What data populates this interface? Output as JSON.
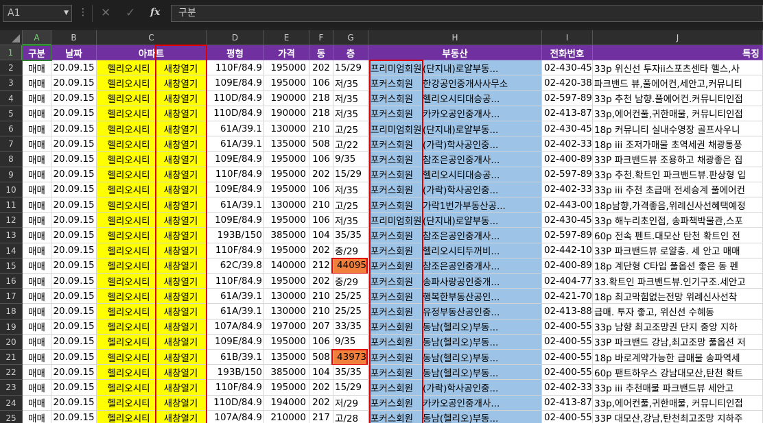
{
  "formula_bar": {
    "name_box": "A1",
    "dropdown_icon": "chevron-down-icon",
    "more_icon": "⋮",
    "cancel_icon": "✕",
    "enter_icon": "✓",
    "fx_label": "fx",
    "content": "구분"
  },
  "columns": [
    "A",
    "B",
    "C",
    "D",
    "E",
    "F",
    "G",
    "H",
    "I",
    "J"
  ],
  "headers": [
    "구분",
    "날짜",
    "아파트",
    "",
    "평형",
    "가격",
    "동",
    "층",
    "부동산",
    "",
    "전화번호",
    "특징"
  ],
  "rows": [
    {
      "n": "2",
      "a": "매매",
      "b": "20.09.15",
      "c1": "헬리오시티",
      "c2": "새창열기",
      "d": "110F/84.9",
      "e": "195000",
      "f": "202",
      "g": "15/29",
      "h1": "프리미엄회원",
      "h2": "(단지내)로얄부동...",
      "i": "02-430-45",
      "j": "33p 위신선 투자ii스포츠센타 헬스,사"
    },
    {
      "n": "3",
      "a": "매매",
      "b": "20.09.15",
      "c1": "헬리오시티",
      "c2": "새창열기",
      "d": "109E/84.9",
      "e": "195000",
      "f": "106",
      "g": "저/35",
      "h1": "포커스회원",
      "h2": "한강공인중개사사무소",
      "i": "02-420-38",
      "j": "파크밴드 뷰,풀에어컨,세안고,커뮤니티"
    },
    {
      "n": "4",
      "a": "매매",
      "b": "20.09.15",
      "c1": "헬리오시티",
      "c2": "새창열기",
      "d": "110D/84.9",
      "e": "190000",
      "f": "218",
      "g": "저/35",
      "h1": "포커스회원",
      "h2": "헬리오시티대승공...",
      "i": "02-597-89",
      "j": "33p 추천 남향.풀에어컨.커뮤니티인접"
    },
    {
      "n": "5",
      "a": "매매",
      "b": "20.09.15",
      "c1": "헬리오시티",
      "c2": "새창열기",
      "d": "110D/84.9",
      "e": "190000",
      "f": "218",
      "g": "저/35",
      "h1": "포커스회원",
      "h2": "카카오공인중개사...",
      "i": "02-413-87",
      "j": "33p,에어컨풀,귀한매물, 커뮤니티인접"
    },
    {
      "n": "6",
      "a": "매매",
      "b": "20.09.15",
      "c1": "헬리오시티",
      "c2": "새창열기",
      "d": "61A/39.1",
      "e": "130000",
      "f": "210",
      "g": "고/25",
      "h1": "프리미엄회원",
      "h2": "(단지내)로얄부동...",
      "i": "02-430-45",
      "j": "18p 커뮤니티 실내수영장 골프사우니"
    },
    {
      "n": "7",
      "a": "매매",
      "b": "20.09.15",
      "c1": "헬리오시티",
      "c2": "새창열기",
      "d": "61A/39.1",
      "e": "135000",
      "f": "508",
      "g": "고/22",
      "h1": "포커스회원",
      "h2": "(가락)학사공인중...",
      "i": "02-402-33",
      "j": "18p iii 조저가매물 초역세권 채광통풍"
    },
    {
      "n": "8",
      "a": "매매",
      "b": "20.09.15",
      "c1": "헬리오시티",
      "c2": "새창열기",
      "d": "109E/84.9",
      "e": "195000",
      "f": "106",
      "g": "9/35",
      "h1": "포커스회원",
      "h2": "참조은공인중개사...",
      "i": "02-400-89",
      "j": "33P 파크밴드뷰 조용하고 채광좋은 집"
    },
    {
      "n": "9",
      "a": "매매",
      "b": "20.09.15",
      "c1": "헬리오시티",
      "c2": "새창열기",
      "d": "110F/84.9",
      "e": "195000",
      "f": "202",
      "g": "15/29",
      "h1": "포커스회원",
      "h2": "헬리오시티대승공...",
      "i": "02-597-89",
      "j": "33p 추천.확트인 파크밴드뷰.판상형 입"
    },
    {
      "n": "10",
      "a": "매매",
      "b": "20.09.15",
      "c1": "헬리오시티",
      "c2": "새창열기",
      "d": "109E/84.9",
      "e": "195000",
      "f": "106",
      "g": "저/35",
      "h1": "포커스회원",
      "h2": "(가락)학사공인중...",
      "i": "02-402-33",
      "j": "33p iii 추천 초급매 전세승계 풀에어컨"
    },
    {
      "n": "11",
      "a": "매매",
      "b": "20.09.15",
      "c1": "헬리오시티",
      "c2": "새창열기",
      "d": "61A/39.1",
      "e": "130000",
      "f": "210",
      "g": "고/25",
      "h1": "포커스회원",
      "h2": "가락1번가부동산공...",
      "i": "02-443-00",
      "j": "18p남향,가격좋음,위례신사선혜택예정"
    },
    {
      "n": "12",
      "a": "매매",
      "b": "20.09.15",
      "c1": "헬리오시티",
      "c2": "새창열기",
      "d": "109E/84.9",
      "e": "195000",
      "f": "106",
      "g": "저/35",
      "h1": "프리미엄회원",
      "h2": "(단지내)로얄부동...",
      "i": "02-430-45",
      "j": "33p 해누리초인접, 송파책박물관,스포"
    },
    {
      "n": "13",
      "a": "매매",
      "b": "20.09.15",
      "c1": "헬리오시티",
      "c2": "새창열기",
      "d": "193B/150",
      "e": "385000",
      "f": "104",
      "g": "35/35",
      "h1": "포커스회원",
      "h2": "참조은공인중개사...",
      "i": "02-597-89",
      "j": "60p 전속 펜트.대모산 탄천 확트인 전"
    },
    {
      "n": "14",
      "a": "매매",
      "b": "20.09.15",
      "c1": "헬리오시티",
      "c2": "새창열기",
      "d": "110F/84.9",
      "e": "195000",
      "f": "202",
      "g": "중/29",
      "h1": "포커스회원",
      "h2": "헬리오시티두꺼비...",
      "i": "02-442-10",
      "j": "33P 파크밴드뷰 로얄층. 세 안고 매매"
    },
    {
      "n": "15",
      "a": "매매",
      "b": "20.09.15",
      "c1": "헬리오시티",
      "c2": "새창열기",
      "d": "62C/39.8",
      "e": "140000",
      "f": "212",
      "g": "44095",
      "h1": "포커스회원",
      "h2": "참조은공인중개사...",
      "i": "02-400-89",
      "j": "18p 계단형 C타입 풀옵션 좋은 동 펜"
    },
    {
      "n": "16",
      "a": "매매",
      "b": "20.09.15",
      "c1": "헬리오시티",
      "c2": "새창열기",
      "d": "110F/84.9",
      "e": "195000",
      "f": "202",
      "g": "중/29",
      "h1": "포커스회원",
      "h2": "송파사랑공인중개...",
      "i": "02-404-77",
      "j": "33.확트인 파크밴드뷰.인기구조.세안고"
    },
    {
      "n": "17",
      "a": "매매",
      "b": "20.09.15",
      "c1": "헬리오시티",
      "c2": "새창열기",
      "d": "61A/39.1",
      "e": "130000",
      "f": "210",
      "g": "25/25",
      "h1": "포커스회원",
      "h2": "행복한부동산공인...",
      "i": "02-421-70",
      "j": "18p 최고막힘없는전망 위례신사선착"
    },
    {
      "n": "18",
      "a": "매매",
      "b": "20.09.15",
      "c1": "헬리오시티",
      "c2": "새창열기",
      "d": "61A/39.1",
      "e": "130000",
      "f": "210",
      "g": "25/25",
      "h1": "포커스회원",
      "h2": "유정부동산공인중...",
      "i": "02-413-88",
      "j": "급매. 투자 좋고, 위신선 수혜동"
    },
    {
      "n": "19",
      "a": "매매",
      "b": "20.09.15",
      "c1": "헬리오시티",
      "c2": "새창열기",
      "d": "107A/84.9",
      "e": "197000",
      "f": "207",
      "g": "33/35",
      "h1": "포커스회원",
      "h2": "동남(헬리오)부동...",
      "i": "02-400-55",
      "j": "33p 남향 최고조망권 단지 중앙 지하"
    },
    {
      "n": "20",
      "a": "매매",
      "b": "20.09.15",
      "c1": "헬리오시티",
      "c2": "새창열기",
      "d": "109E/84.9",
      "e": "195000",
      "f": "106",
      "g": "9/35",
      "h1": "포커스회원",
      "h2": "동남(헬리오)부동...",
      "i": "02-400-55",
      "j": "33P 파크밴드 강남,최고조망 풀옵션 저"
    },
    {
      "n": "21",
      "a": "매매",
      "b": "20.09.15",
      "c1": "헬리오시티",
      "c2": "새창열기",
      "d": "61B/39.1",
      "e": "135000",
      "f": "508",
      "g": "43973",
      "h1": "포커스회원",
      "h2": "동남(헬리오)부동...",
      "i": "02-400-55",
      "j": "18p 바로계약가능한 급매물 송파역세"
    },
    {
      "n": "22",
      "a": "매매",
      "b": "20.09.15",
      "c1": "헬리오시티",
      "c2": "새창열기",
      "d": "193B/150",
      "e": "385000",
      "f": "104",
      "g": "35/35",
      "h1": "포커스회원",
      "h2": "동남(헬리오)부동...",
      "i": "02-400-55",
      "j": "60p 팬트하우스 강남대모산,탄천 확트"
    },
    {
      "n": "23",
      "a": "매매",
      "b": "20.09.15",
      "c1": "헬리오시티",
      "c2": "새창열기",
      "d": "110F/84.9",
      "e": "195000",
      "f": "202",
      "g": "15/29",
      "h1": "포커스회원",
      "h2": "(가락)학사공인중...",
      "i": "02-402-33",
      "j": "33p iii 추천매물 파크밴드뷰 세안고"
    },
    {
      "n": "24",
      "a": "매매",
      "b": "20.09.15",
      "c1": "헬리오시티",
      "c2": "새창열기",
      "d": "110D/84.9",
      "e": "194000",
      "f": "202",
      "g": "저/29",
      "h1": "포커스회원",
      "h2": "카카오공인중개사...",
      "i": "02-413-87",
      "j": "33p,에어컨풀,귀한매물, 커뮤니티인접"
    },
    {
      "n": "25",
      "a": "매매",
      "b": "20.09.15",
      "c1": "헬리오시티",
      "c2": "새창열기",
      "d": "107A/84.9",
      "e": "210000",
      "f": "217",
      "g": "고/28",
      "h1": "포커스회원",
      "h2": "동남(헬리오)부동...",
      "i": "02-400-55",
      "j": "33P 대모산,강남,탄천최고조망 지하주"
    }
  ],
  "colors": {
    "header_purple": "#7030a0",
    "highlight_yellow": "#ffff00",
    "realtor_blue": "#9dc3e6",
    "date_orange": "#f07f3c",
    "annotation_red": "#e00000",
    "selection_green": "#3f9c3f"
  }
}
